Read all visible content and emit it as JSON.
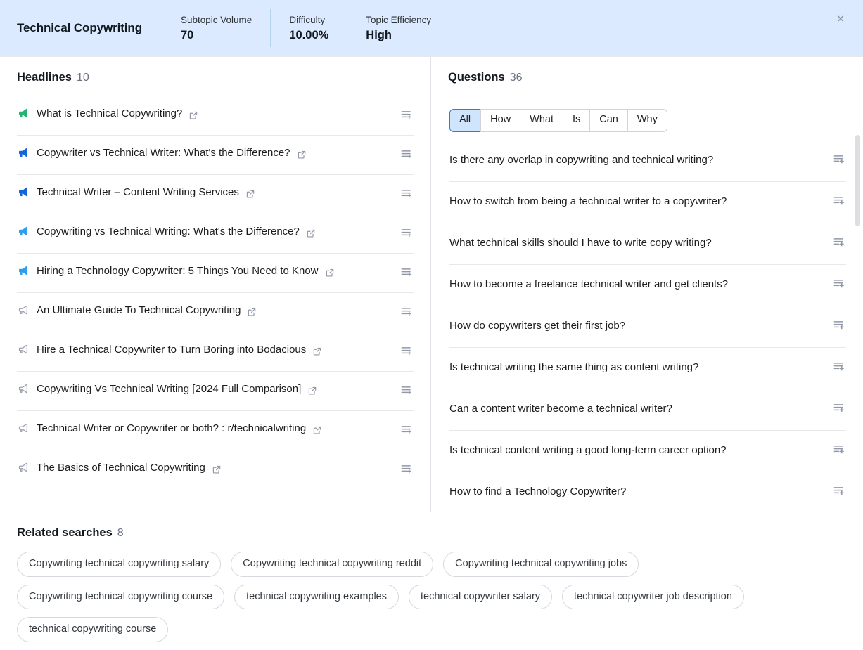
{
  "header": {
    "title": "Technical Copywriting",
    "metrics": [
      {
        "label": "Subtopic Volume",
        "value": "70"
      },
      {
        "label": "Difficulty",
        "value": "10.00%"
      },
      {
        "label": "Topic Efficiency",
        "value": "High"
      }
    ],
    "close_label": "×",
    "background_color": "#dbeafe"
  },
  "headlines_panel": {
    "title": "Headlines",
    "count": "10",
    "items": [
      {
        "text": "What is Technical Copywriting?",
        "icon": "megaphone-icon",
        "icon_color": "#21b573",
        "icon_style": "solid",
        "external_link": true
      },
      {
        "text": "Copywriter vs Technical Writer: What's the Difference?",
        "icon": "megaphone-icon",
        "icon_color": "#1565d8",
        "icon_style": "solid",
        "external_link": true
      },
      {
        "text": "Technical Writer – Content Writing Services",
        "icon": "megaphone-icon",
        "icon_color": "#1565d8",
        "icon_style": "solid",
        "external_link": true
      },
      {
        "text": "Copywriting vs Technical Writing: What's the Difference?",
        "icon": "megaphone-icon",
        "icon_color": "#2e9fe8",
        "icon_style": "solid",
        "external_link": true
      },
      {
        "text": "Hiring a Technology Copywriter: 5 Things You Need to Know",
        "icon": "megaphone-icon",
        "icon_color": "#2e9fe8",
        "icon_style": "solid",
        "external_link": true
      },
      {
        "text": "An Ultimate Guide To Technical Copywriting",
        "icon": "megaphone-icon",
        "icon_color": "#9a9fab",
        "icon_style": "outline",
        "external_link": true
      },
      {
        "text": "Hire a Technical Copywriter to Turn Boring into Bodacious",
        "icon": "megaphone-icon",
        "icon_color": "#9a9fab",
        "icon_style": "outline",
        "external_link": true
      },
      {
        "text": "Copywriting Vs Technical Writing [2024 Full Comparison]",
        "icon": "megaphone-icon",
        "icon_color": "#9a9fab",
        "icon_style": "outline",
        "external_link": true
      },
      {
        "text": "Technical Writer or Copywriter or both? : r/technicalwriting",
        "icon": "megaphone-icon",
        "icon_color": "#9a9fab",
        "icon_style": "outline",
        "external_link": true
      },
      {
        "text": "The Basics of Technical Copywriting",
        "icon": "megaphone-icon",
        "icon_color": "#9a9fab",
        "icon_style": "outline",
        "external_link": true
      }
    ]
  },
  "questions_panel": {
    "title": "Questions",
    "count": "36",
    "filters": [
      {
        "label": "All",
        "active": true
      },
      {
        "label": "How",
        "active": false
      },
      {
        "label": "What",
        "active": false
      },
      {
        "label": "Is",
        "active": false
      },
      {
        "label": "Can",
        "active": false
      },
      {
        "label": "Why",
        "active": false
      }
    ],
    "items": [
      {
        "text": "Is there any overlap in copywriting and technical writing?"
      },
      {
        "text": "How to switch from being a technical writer to a copywriter?"
      },
      {
        "text": "What technical skills should I have to write copy writing?"
      },
      {
        "text": "How to become a freelance technical writer and get clients?"
      },
      {
        "text": "How do copywriters get their first job?"
      },
      {
        "text": "Is technical writing the same thing as content writing?"
      },
      {
        "text": "Can a content writer become a technical writer?"
      },
      {
        "text": "Is technical content writing a good long-term career option?"
      },
      {
        "text": "How to find a Technology Copywriter?"
      }
    ]
  },
  "related_searches": {
    "title": "Related searches",
    "count": "8",
    "chips": [
      "Copywriting technical copywriting salary",
      "Copywriting technical copywriting reddit",
      "Copywriting technical copywriting jobs",
      "Copywriting technical copywriting course",
      "technical copywriting examples",
      "technical copywriter salary",
      "technical copywriter job description",
      "technical copywriting course"
    ]
  },
  "icons": {
    "add_to_list": "add-to-list-icon",
    "external_link": "external-link-icon"
  },
  "colors": {
    "accent_blue": "#2f7be5",
    "header_bg": "#dbeafe",
    "active_filter_bg": "#cfe5fd"
  }
}
